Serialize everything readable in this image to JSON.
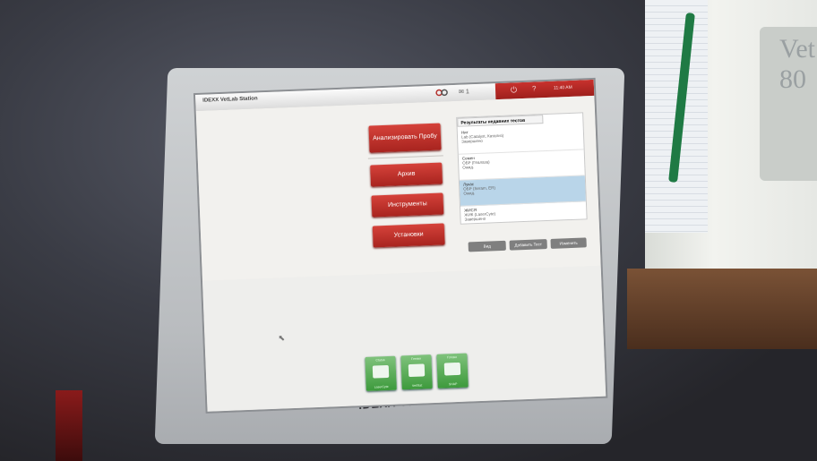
{
  "app": {
    "title": "IDEXX VetLab Station",
    "time": "11:40 AM",
    "messages_count": "1",
    "monitor_brand": "IDEXX VetLab Station",
    "side_device_brand": "Vet 80"
  },
  "main": {
    "analyze_button": "Анализировать Пробу",
    "archive_button": "Архив",
    "tools_button": "Инструменты",
    "settings_button": "Установки"
  },
  "results": {
    "header": "Результаты недавних тестов",
    "items": [
      {
        "name": "Нит",
        "line2": "Lab (Catalyst, Катализ)",
        "line3": "Завершено"
      },
      {
        "name": "Семен",
        "line2": "ОБР (Геалаза)",
        "line3": "Ожид."
      },
      {
        "name": "Лукас",
        "line2": "ОБР (Seram, ER)",
        "line3": "Ожид."
      },
      {
        "name": "ЖИСЯ",
        "line2": "ЖИК (LaserCyte)",
        "line3": "Завершено"
      }
    ],
    "selected_index": 2,
    "buttons": {
      "view": "Вид",
      "add_test": "Добавить Тест",
      "edit": "Изменить"
    }
  },
  "dock": {
    "tiles": [
      {
        "top": "Сtatus",
        "label": "LaserCyte"
      },
      {
        "top": "Готово",
        "label": "VetStat"
      },
      {
        "top": "Готово",
        "label": "SNAP"
      }
    ]
  },
  "colors": {
    "accent_red": "#c8322e",
    "dock_green": "#4ea94b",
    "selection_blue": "#b9d5e9"
  }
}
